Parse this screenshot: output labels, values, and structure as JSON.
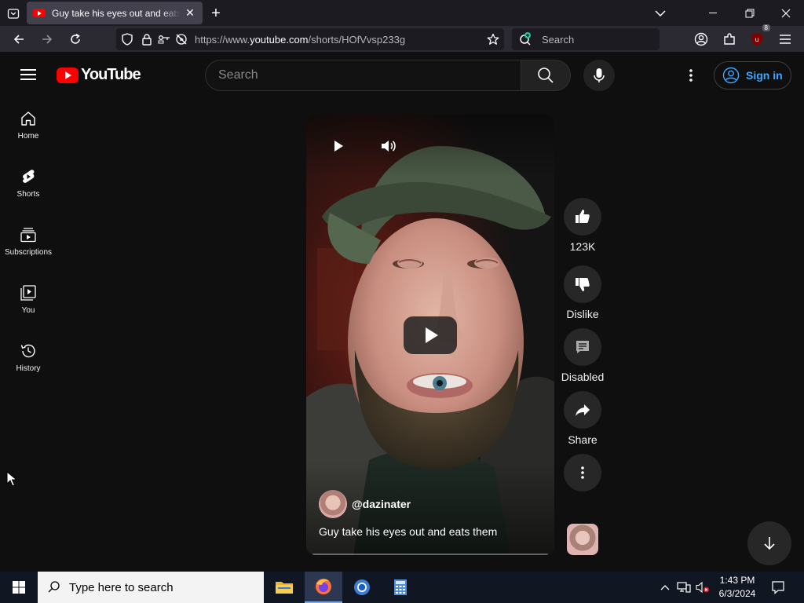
{
  "browser": {
    "tab": {
      "title": "Guy take his eyes out and eats them"
    },
    "url": {
      "prefix": "https://www.",
      "domain": "youtube.com",
      "path": "/shorts/HOfVvsp233g"
    },
    "search_placeholder": "Search",
    "extension_badge": "8"
  },
  "youtube": {
    "logo_text": "YouTube",
    "search_placeholder": "Search",
    "signin_label": "Sign in",
    "guide": [
      {
        "label": "Home",
        "icon": "home-icon"
      },
      {
        "label": "Shorts",
        "icon": "shorts-icon"
      },
      {
        "label": "Subscriptions",
        "icon": "subscriptions-icon"
      },
      {
        "label": "You",
        "icon": "you-icon"
      },
      {
        "label": "History",
        "icon": "history-icon"
      }
    ],
    "short": {
      "channel": "@dazinater",
      "caption": "Guy take his eyes out and eats them"
    },
    "actions": {
      "like_count": "123K",
      "dislike_label": "Dislike",
      "comments_label": "Disabled",
      "share_label": "Share"
    }
  },
  "taskbar": {
    "search_placeholder": "Type here to search",
    "time": "1:43 PM",
    "date": "6/3/2024"
  }
}
